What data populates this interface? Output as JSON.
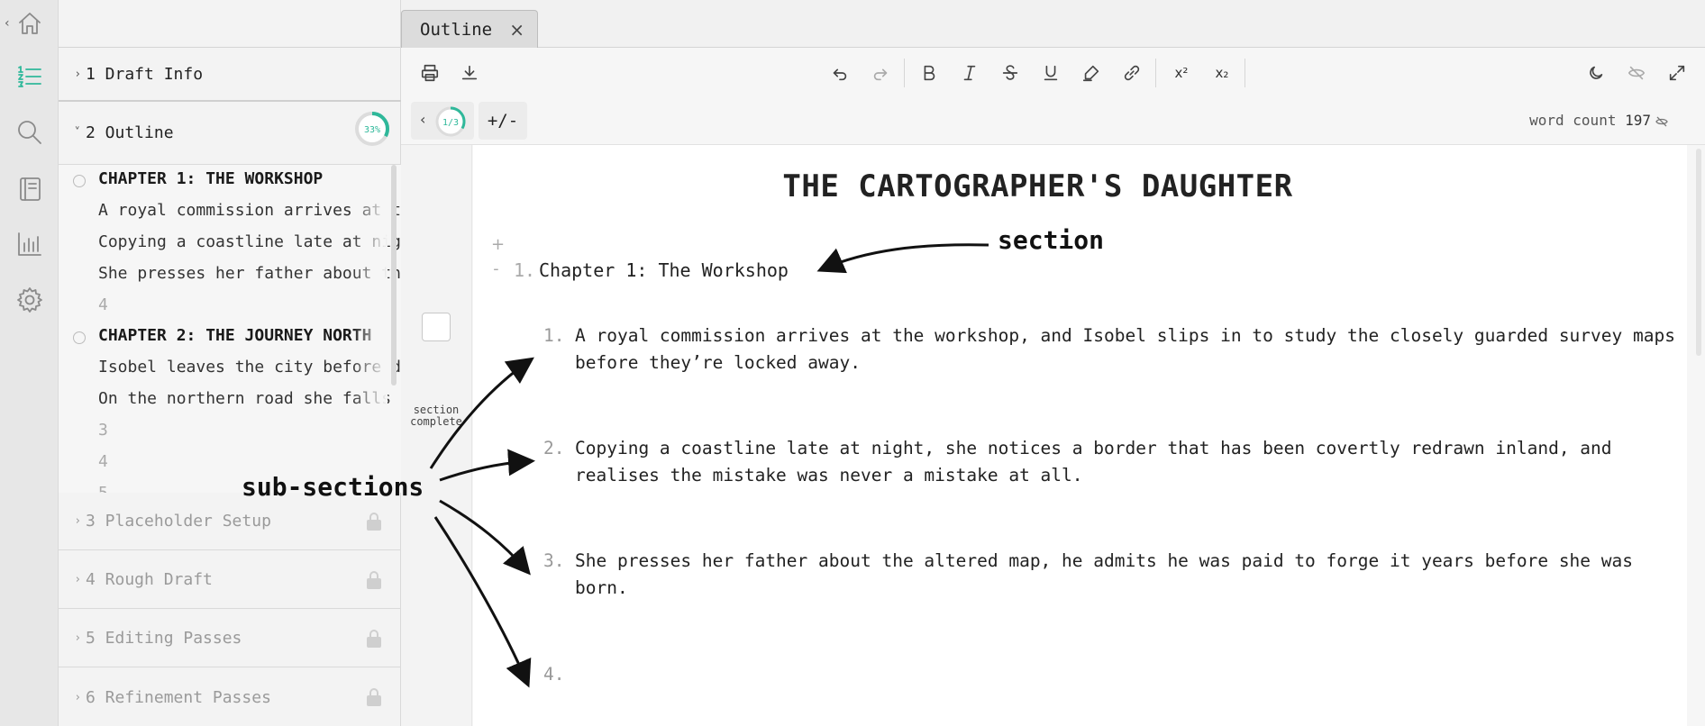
{
  "sidebar": {
    "sections": [
      {
        "label": "1 Draft Info",
        "expanded": false,
        "locked": false
      },
      {
        "label": "2 Outline",
        "expanded": true,
        "locked": false,
        "progress": "33%"
      },
      {
        "label": "3 Placeholder Setup",
        "expanded": false,
        "locked": true
      },
      {
        "label": "4 Rough Draft",
        "expanded": false,
        "locked": true
      },
      {
        "label": "5 Editing Passes",
        "expanded": false,
        "locked": true
      },
      {
        "label": "6 Refinement Passes",
        "expanded": false,
        "locked": true
      }
    ],
    "outline": [
      {
        "kind": "chapter",
        "text": "CHAPTER 1: THE WORKSHOP"
      },
      {
        "kind": "sub",
        "text": "A royal commission arrives at the workshop"
      },
      {
        "kind": "sub",
        "text": "Copying a coastline late at night"
      },
      {
        "kind": "sub",
        "text": "She presses her father about the altered map"
      },
      {
        "kind": "num",
        "text": "4"
      },
      {
        "kind": "chapter",
        "text": "CHAPTER 2: THE JOURNEY NORTH"
      },
      {
        "kind": "sub",
        "text": "Isobel leaves the city before dawn"
      },
      {
        "kind": "sub",
        "text": "On the northern road she falls in with"
      },
      {
        "kind": "num",
        "text": "3"
      },
      {
        "kind": "num",
        "text": "4"
      },
      {
        "kind": "num",
        "text": "5"
      }
    ]
  },
  "tabs": [
    {
      "label": "Outline",
      "close": "×"
    }
  ],
  "toolbar": {
    "superscript": "x²",
    "subscript": "x₂"
  },
  "subbar": {
    "page_indicator": "1/3",
    "plus_minus": "+/-",
    "word_count_label": "word count",
    "word_count": "197"
  },
  "gutter": {
    "section_complete": "section complete"
  },
  "document": {
    "title": "THE CARTOGRAPHER'S DAUGHTER",
    "plus": "+",
    "minus": "-",
    "section_number": "1.",
    "section_title": "Chapter 1: The Workshop",
    "subsections": [
      {
        "n": "1.",
        "text": "A royal commission arrives at the workshop, and Isobel slips in to study the closely guarded survey maps before they’re locked away."
      },
      {
        "n": "2.",
        "text": "Copying a coastline late at night, she notices a border that has been covertly redrawn inland, and realises the mistake was never a mistake at all."
      },
      {
        "n": "3.",
        "text": "She presses her father about the altered map, he admits he was paid to forge it years before she was born."
      },
      {
        "n": "4.",
        "text": ""
      }
    ]
  },
  "annotations": {
    "section": "section",
    "subsections": "sub-sections"
  },
  "colors": {
    "accent": "#2fb89a"
  }
}
